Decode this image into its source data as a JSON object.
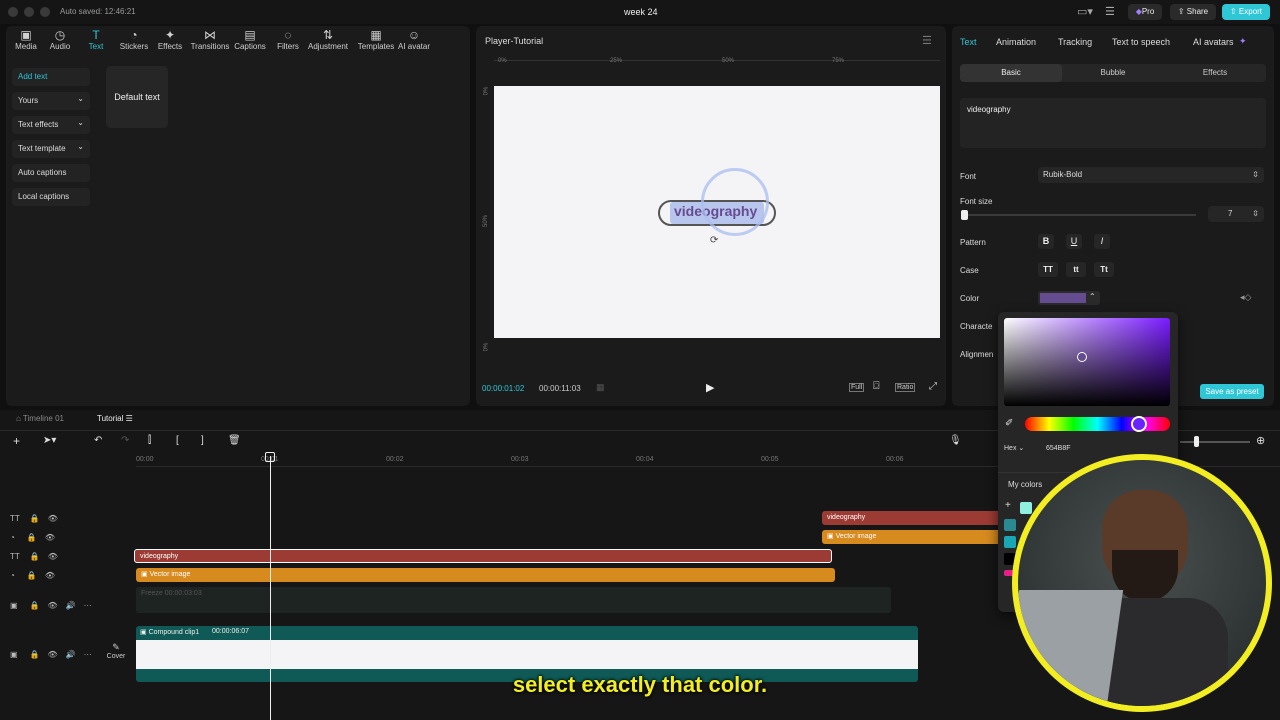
{
  "topbar": {
    "autosave": "Auto saved: 12:46:21",
    "title": "week 24",
    "pro": "Pro",
    "share": "Share",
    "export": "Export"
  },
  "toolbar": [
    {
      "label": "Media",
      "icon": "media-icon",
      "glyph": "▣"
    },
    {
      "label": "Audio",
      "icon": "audio-icon",
      "glyph": "◷"
    },
    {
      "label": "Text",
      "icon": "text-icon",
      "glyph": "T"
    },
    {
      "label": "Stickers",
      "icon": "stickers-icon",
      "glyph": "◔"
    },
    {
      "label": "Effects",
      "icon": "effects-icon",
      "glyph": "✦"
    },
    {
      "label": "Transitions",
      "icon": "transitions-icon",
      "glyph": "⋈"
    },
    {
      "label": "Captions",
      "icon": "captions-icon",
      "glyph": "▤"
    },
    {
      "label": "Filters",
      "icon": "filters-icon",
      "glyph": "◌"
    },
    {
      "label": "Adjustment",
      "icon": "adjustment-icon",
      "glyph": "⇅"
    },
    {
      "label": "Templates",
      "icon": "templates-icon",
      "glyph": "▦"
    },
    {
      "label": "AI avatar",
      "icon": "ai-avatar-icon",
      "glyph": "☺"
    }
  ],
  "sidebar": [
    "Add text",
    "Yours",
    "Text effects",
    "Text template",
    "Auto captions",
    "Local captions"
  ],
  "default_text": "Default text",
  "player": {
    "title": "Player-Tutorial",
    "ruler": [
      "0%",
      "25%",
      "50%",
      "75%"
    ],
    "vruler": [
      "0%",
      "50%",
      "0%"
    ],
    "text": "videography",
    "current_time": "00:00:01:02",
    "total_time": "00:00:11:03",
    "full": "Full",
    "ratio": "Ratio"
  },
  "right": {
    "tabs": [
      "Text",
      "Animation",
      "Tracking",
      "Text to speech",
      "AI avatars"
    ],
    "subtabs": [
      "Basic",
      "Bubble",
      "Effects"
    ],
    "text_value": "videography",
    "font_label": "Font",
    "font_value": "Rubik-Bold",
    "fontsize_label": "Font size",
    "fontsize_value": "7",
    "pattern_label": "Pattern",
    "pattern": [
      "B",
      "U",
      "I"
    ],
    "case_label": "Case",
    "case": [
      "TT",
      "tt",
      "Tt"
    ],
    "color_label": "Color",
    "character_label": "Characte",
    "alignment_label": "Alignmen",
    "save_preset": "Save as preset"
  },
  "colorpicker": {
    "mode": "Hex",
    "hex": "654B8F",
    "my_colors": "My colors"
  },
  "timeline": {
    "tab1": "Timeline 01",
    "tab2": "Tutorial",
    "ticks": [
      "00:00",
      "00:01",
      "00:02",
      "00:03",
      "00:04",
      "00:05",
      "00:06"
    ],
    "clip_text": "videography",
    "clip_vector": "Vector image",
    "freeze": "Freeze  00:00:03:03",
    "compound": "Compound clip1",
    "compound_time": "00:00:06:07",
    "cover": "Cover"
  },
  "subtitle": "select exactly that color.",
  "colors": {
    "accent": "#2fc6d6",
    "text_clip": "#9c3b33",
    "vector_clip": "#d78a1e",
    "compound": "#0f5a56",
    "picker_hex": "#654B8F",
    "webcam_ring": "#f2ee21"
  }
}
